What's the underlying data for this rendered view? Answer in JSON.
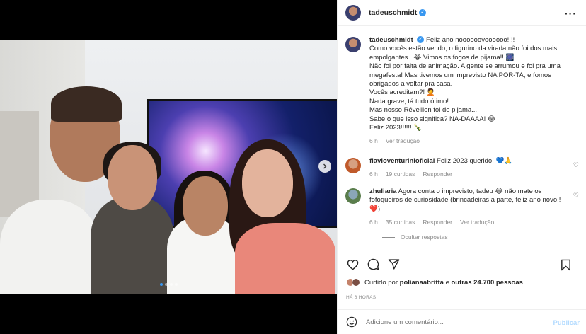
{
  "post": {
    "username": "tadeuschmidt",
    "verified_mark": "✓",
    "more_icon": "more-options-icon",
    "carousel": {
      "slides": 4,
      "active_index": 0
    }
  },
  "caption": {
    "username": "tadeuschmidt",
    "text": "Feliz ano noooooovoooooo!!!!\nComo vocês estão vendo, o figurino da virada não foi dos mais empolgantes...😂 Vimos os fogos de pijama!! 🎆\nNão foi por falta de animação. A gente se arrumou e foi pra uma megafesta! Mas tivemos um imprevisto NA POR-TA, e fomos obrigados a voltar pra casa.\nVocês acreditam?! 🤦\nNada grave, tá tudo ótimo!\nMas nosso Réveillon foi de pijama...\nSabe o que isso significa? NA-DAAAA! 😂\nFeliz 2023!!!!!! 🍾",
    "time": "6 h",
    "see_translation": "Ver tradução"
  },
  "comments": [
    {
      "username": "flavioventurinioficial",
      "text": "Feliz 2023 querido! 💙🙏",
      "time": "6 h",
      "likes": "19 curtidas",
      "reply": "Responder"
    },
    {
      "username": "zhuliaria",
      "text": "Agora conta o imprevisto, tadeu 😂 não mate os fofoqueiros de curiosidade (brincadeiras a parte, feliz ano novo!! ❤️)",
      "time": "6 h",
      "likes": "35 curtidas",
      "reply": "Responder",
      "see_translation": "Ver tradução"
    }
  ],
  "hide_replies": "Ocultar respostas",
  "likes": {
    "prefix": "Curtido por ",
    "user": "polianaabritta",
    "middle": " e ",
    "others": "outras 24.700 pessoas"
  },
  "timestamp": "HÁ 6 HORAS",
  "add_comment": {
    "placeholder": "Adicione um comentário...",
    "publish": "Publicar"
  },
  "colors": {
    "accent": "#3897f0",
    "muted": "#8e8e8e",
    "publish_disabled": "#b3dbff"
  }
}
